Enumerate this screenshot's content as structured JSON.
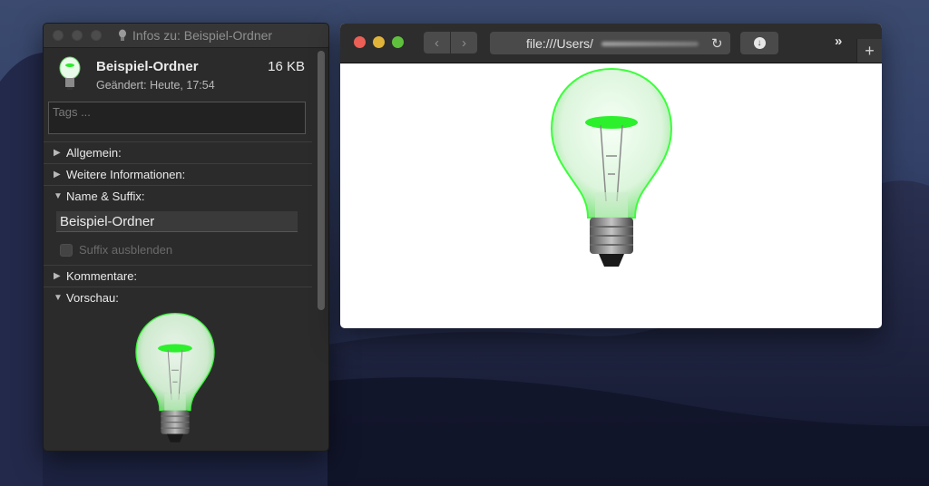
{
  "info_window": {
    "title": "Infos zu: Beispiel-Ordner",
    "name": "Beispiel-Ordner",
    "size": "16 KB",
    "modified": "Geändert: Heute, 17:54",
    "tags_placeholder": "Tags ...",
    "sections": {
      "general": "Allgemein:",
      "more_info": "Weitere Informationen:",
      "name_suffix": "Name & Suffix:",
      "comments": "Kommentare:",
      "preview": "Vorschau:"
    },
    "name_field_value": "Beispiel-Ordner",
    "hide_suffix_label": "Suffix ausblenden",
    "hide_suffix_checked": false
  },
  "browser": {
    "url": "file:///Users/",
    "nav_back_icon": "chevron-left-icon",
    "nav_forward_icon": "chevron-right-icon",
    "reload_icon": "reload-icon",
    "download_icon": "download-icon",
    "overflow_icon": "»",
    "new_tab_icon": "+"
  },
  "colors": {
    "close": "#ec5f56",
    "minimize": "#e0b43a",
    "zoom": "#5fc03d",
    "bulb_glow": "#3bff3b"
  }
}
